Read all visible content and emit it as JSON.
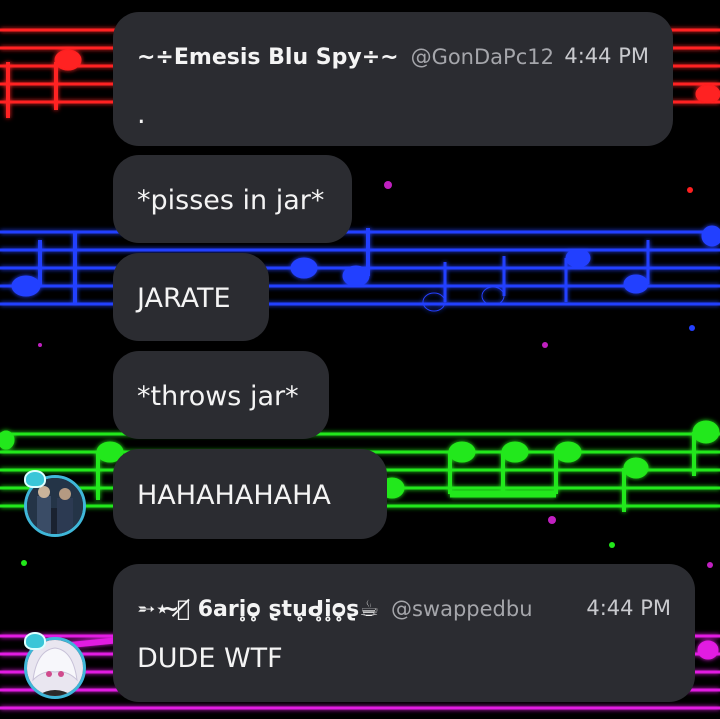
{
  "chat": {
    "messages": [
      {
        "author": "~÷Emesis Blu Spy÷~",
        "handle": "@GonDaPc12",
        "time": "4:44 PM",
        "lines": [
          ".",
          "*pisses in jar*",
          "JARATE",
          "*throws jar*",
          "HAHAHAHAHA"
        ]
      },
      {
        "author": "➵⋆ ̴⃝̸̸ 6ari̥ᴑ̥ ʂtu̥ᑯ̥i̥ᴑ̥ʂ☕",
        "handle": "@swappedbu",
        "time": "4:44 PM",
        "lines": [
          "DUDE WTF"
        ]
      }
    ]
  },
  "background": {
    "staff_colors": [
      "#ff1a1a",
      "#1a3cff",
      "#22e81a",
      "#e11ae1"
    ],
    "description_icons": [
      "music-staff-red",
      "music-staff-blue",
      "music-staff-green",
      "music-staff-magenta"
    ]
  }
}
